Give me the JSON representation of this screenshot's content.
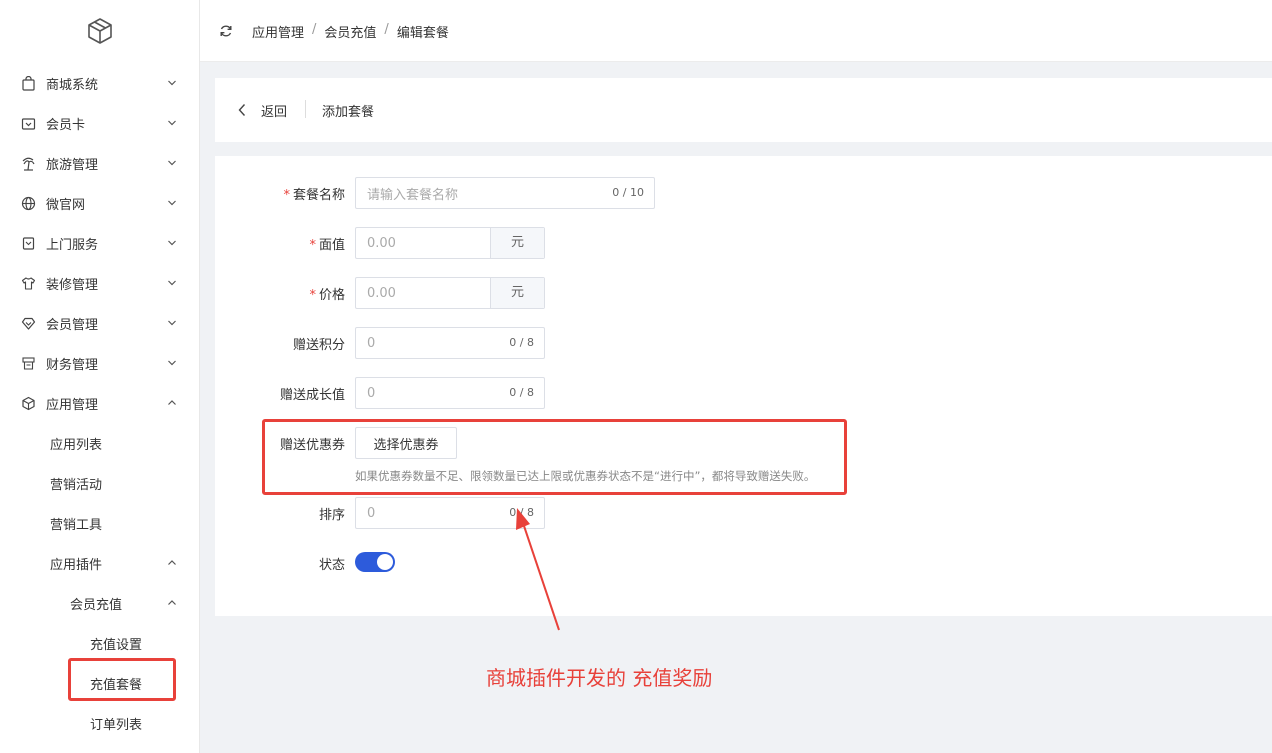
{
  "colors": {
    "accent": "#2d5bdb",
    "annotation": "#e8413a",
    "required": "#e8413a"
  },
  "sidebar": {
    "logo_icon": "cube-icon",
    "items": [
      {
        "label": "商城系统",
        "icon": "bag-icon",
        "expanded": false
      },
      {
        "label": "会员卡",
        "icon": "card-icon",
        "expanded": false
      },
      {
        "label": "旅游管理",
        "icon": "palm-icon",
        "expanded": false
      },
      {
        "label": "微官网",
        "icon": "globe-icon",
        "expanded": false
      },
      {
        "label": "上门服务",
        "icon": "book-icon",
        "expanded": false
      },
      {
        "label": "装修管理",
        "icon": "shirt-icon",
        "expanded": false
      },
      {
        "label": "会员管理",
        "icon": "diamond-icon",
        "expanded": false
      },
      {
        "label": "财务管理",
        "icon": "register-icon",
        "expanded": false
      },
      {
        "label": "应用管理",
        "icon": "box-icon",
        "expanded": true
      }
    ],
    "sub_items": {
      "app_list": "应用列表",
      "marketing_activity": "营销活动",
      "marketing_tools": "营销工具",
      "app_plugins": "应用插件",
      "member_recharge": "会员充值",
      "recharge_settings": "充值设置",
      "recharge_package": "充值套餐",
      "order_list": "订单列表"
    }
  },
  "header": {
    "breadcrumb": [
      "应用管理",
      "会员充值",
      "编辑套餐"
    ],
    "separator": "/"
  },
  "back_bar": {
    "back_label": "返回",
    "title": "添加套餐"
  },
  "form": {
    "package_name": {
      "label": "套餐名称",
      "required": "*",
      "placeholder": "请输入套餐名称",
      "count": "0 / 10"
    },
    "face_value": {
      "label": "面值",
      "required": "*",
      "placeholder": "0.00",
      "unit": "元"
    },
    "price": {
      "label": "价格",
      "required": "*",
      "placeholder": "0.00",
      "unit": "元"
    },
    "bonus_points": {
      "label": "赠送积分",
      "placeholder": "0",
      "count": "0 / 8"
    },
    "bonus_growth": {
      "label": "赠送成长值",
      "placeholder": "0",
      "count": "0 / 8"
    },
    "bonus_coupon": {
      "label": "赠送优惠券",
      "button": "选择优惠券",
      "help": "如果优惠券数量不足、限领数量已达上限或优惠券状态不是“进行中”，都将导致赠送失败。"
    },
    "sort": {
      "label": "排序",
      "placeholder": "0",
      "count": "0 / 8"
    },
    "status": {
      "label": "状态",
      "enabled": true
    }
  },
  "annotation": {
    "text": "商城插件开发的 充值奖励"
  }
}
